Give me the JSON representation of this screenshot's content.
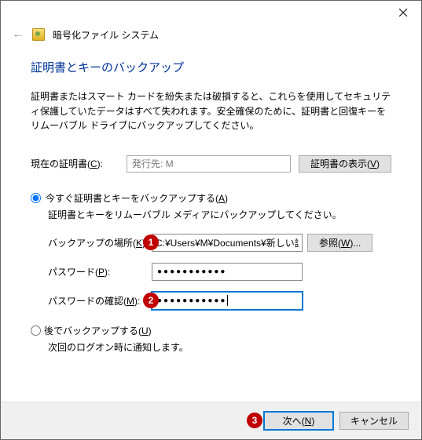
{
  "window": {
    "title": "暗号化ファイル システム"
  },
  "heading": "証明書とキーのバックアップ",
  "description": "証明書またはスマート カードを紛失または破損すると、これらを使用してセキュリティ保護していたデータはすべて失われます。安全確保のために、証明書と回復キーをリムーバブル ドライブにバックアップしてください。",
  "current_cert": {
    "label": "現在の証明書(C):",
    "value": "発行先: M",
    "view_button": "証明書の表示(V)"
  },
  "option_backup_now": {
    "label": "今すぐ証明書とキーをバックアップする(A)",
    "sublabel": "証明書とキーをリムーバブル メディアにバックアップしてください。",
    "location_label": "バックアップの場所(K):",
    "location_value": "C:¥Users¥M¥Documents¥新しい証明",
    "browse_button": "参照(W)...",
    "password_label": "パスワード(P):",
    "password_value": "●●●●●●●●●●●",
    "confirm_label": "パスワードの確認(M):",
    "confirm_value": "●●●●●●●●●●●"
  },
  "option_backup_later": {
    "label": "後でバックアップする(U)",
    "sublabel": "次回のログオン時に通知します。"
  },
  "footer": {
    "next": "次へ(N)",
    "cancel": "キャンセル"
  },
  "badges": {
    "one": "1",
    "two": "2",
    "three": "3"
  }
}
